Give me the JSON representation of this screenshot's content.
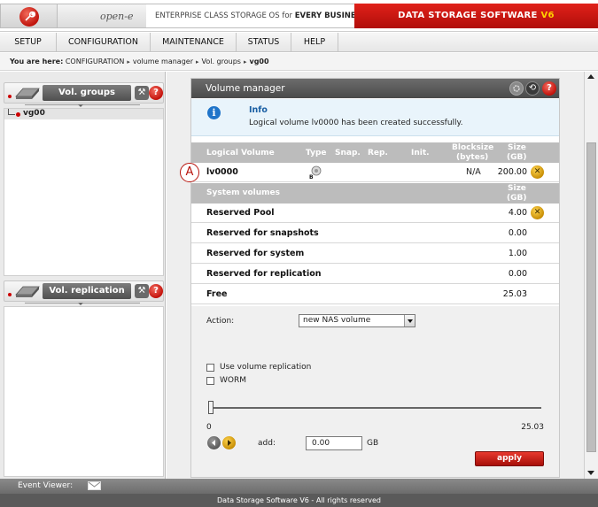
{
  "header": {
    "brand": "open-e",
    "tagline_prefix": "ENTERPRISE CLASS STORAGE OS for ",
    "tagline_bold": "EVERY BUSINESS",
    "banner_text": "DATA STORAGE SOFTWARE",
    "banner_version": "V6"
  },
  "menu": {
    "items": [
      {
        "label": "SETUP"
      },
      {
        "label": "CONFIGURATION"
      },
      {
        "label": "MAINTENANCE"
      },
      {
        "label": "STATUS"
      },
      {
        "label": "HELP"
      }
    ]
  },
  "breadcrumb": {
    "prefix": "You are here:",
    "items": [
      "CONFIGURATION",
      "volume manager",
      "Vol. groups",
      "vg00"
    ]
  },
  "left_panels": {
    "vol_groups": {
      "title": "Vol. groups",
      "items": [
        {
          "label": "vg00"
        }
      ]
    },
    "vol_replication": {
      "title": "Vol. replication"
    }
  },
  "volume_manager": {
    "title": "Volume manager",
    "info": {
      "title": "Info",
      "message": "Logical volume lv0000 has been created successfully."
    },
    "lv_table": {
      "headers": {
        "logical_volume": "Logical Volume",
        "type": "Type",
        "snap": "Snap.",
        "rep": "Rep.",
        "init": "Init.",
        "blocksize": "Blocksize",
        "blocksize_unit": "(bytes)",
        "size": "Size",
        "size_unit": "(GB)"
      },
      "rows": [
        {
          "name": "lv0000",
          "type_icon": "block-volume-icon",
          "blocksize": "N/A",
          "size": "200.00"
        }
      ]
    },
    "system_table": {
      "header": "System volumes",
      "size": "Size",
      "size_unit": "(GB)",
      "rows": [
        {
          "name": "Reserved Pool",
          "value": "4.00"
        },
        {
          "name": "Reserved for snapshots",
          "value": "0.00"
        },
        {
          "name": "Reserved for system",
          "value": "1.00"
        },
        {
          "name": "Reserved for replication",
          "value": "0.00"
        },
        {
          "name": "Free",
          "value": "25.03"
        }
      ]
    },
    "action": {
      "label": "Action:",
      "selected": "new NAS volume"
    },
    "options": {
      "use_volume_replication": "Use volume replication",
      "worm": "WORM"
    },
    "slider": {
      "min": "0",
      "max": "25.03",
      "value": 0
    },
    "add": {
      "label": "add:",
      "value": "0.00",
      "unit": "GB"
    },
    "apply_label": "apply"
  },
  "marker": "A",
  "footer": {
    "event_viewer": "Event Viewer:",
    "copyright": "Data Storage Software V6 - All rights reserved"
  },
  "colors": {
    "brand_red": "#c8140d",
    "header_gray": "#4f4f4f",
    "info_blue": "#1a5fa3"
  }
}
